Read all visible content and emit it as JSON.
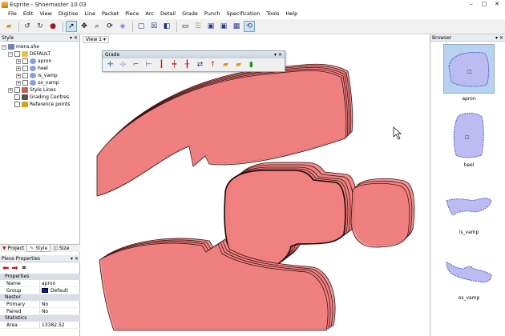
{
  "window": {
    "title": "Esprite - Shoemaster 10.03",
    "controls": [
      "–",
      "□",
      "✕"
    ]
  },
  "menu": [
    "File",
    "Edit",
    "View",
    "Digitise",
    "Line",
    "Packet",
    "Piece",
    "Arc",
    "Detail",
    "Grade",
    "Punch",
    "Specification",
    "Tools",
    "Help"
  ],
  "style_pane": {
    "title": "Style",
    "tree": [
      {
        "label": "mens.she",
        "level": 0,
        "expand": "−",
        "icon": "file"
      },
      {
        "label": "DEFAULT",
        "level": 1,
        "expand": "−",
        "icon": "folder"
      },
      {
        "label": "apron",
        "level": 2,
        "expand": "+",
        "icon": "piece"
      },
      {
        "label": "heel",
        "level": 2,
        "expand": "+",
        "icon": "piece"
      },
      {
        "label": "is_vamp",
        "level": 2,
        "expand": "+",
        "icon": "piece"
      },
      {
        "label": "os_vamp",
        "level": 2,
        "expand": "+",
        "icon": "piece"
      },
      {
        "label": "Style Lines",
        "level": 0,
        "expand": "+",
        "icon": "lines"
      },
      {
        "label": "Grading Centres",
        "level": 0,
        "expand": "",
        "icon": "grading"
      },
      {
        "label": "Reference points",
        "level": 0,
        "expand": "",
        "icon": "ref"
      }
    ],
    "tabs": [
      "Project",
      "Style",
      "Size"
    ],
    "active_tab": "Style"
  },
  "piece_properties": {
    "title": "Piece Properties",
    "sections": [
      {
        "name": "Properties",
        "rows": [
          {
            "key": "Name",
            "value": "apron"
          },
          {
            "key": "Group",
            "value": "Default",
            "swatch": "#0018d8"
          }
        ]
      },
      {
        "name": "Nestor",
        "rows": [
          {
            "key": "Primary",
            "value": "No"
          },
          {
            "key": "Paired",
            "value": "No"
          }
        ]
      },
      {
        "name": "Statistics",
        "rows": [
          {
            "key": "Area",
            "value": "13382.52"
          }
        ]
      }
    ]
  },
  "canvas": {
    "view_label": "View 1 ▾"
  },
  "grade_toolbar": {
    "title": "Grade"
  },
  "browser": {
    "title": "Browser",
    "items": [
      {
        "label": "apron",
        "selected": true
      },
      {
        "label": "heel",
        "selected": false
      },
      {
        "label": "is_vamp",
        "selected": false
      },
      {
        "label": "os_vamp",
        "selected": false
      }
    ]
  },
  "colors": {
    "piece_fill": "#f08080",
    "piece_stroke": "#3a1010",
    "thumb_fill": "#bcbcf2",
    "thumb_stroke": "#5a5acf",
    "selection": "#b7d3f0"
  }
}
